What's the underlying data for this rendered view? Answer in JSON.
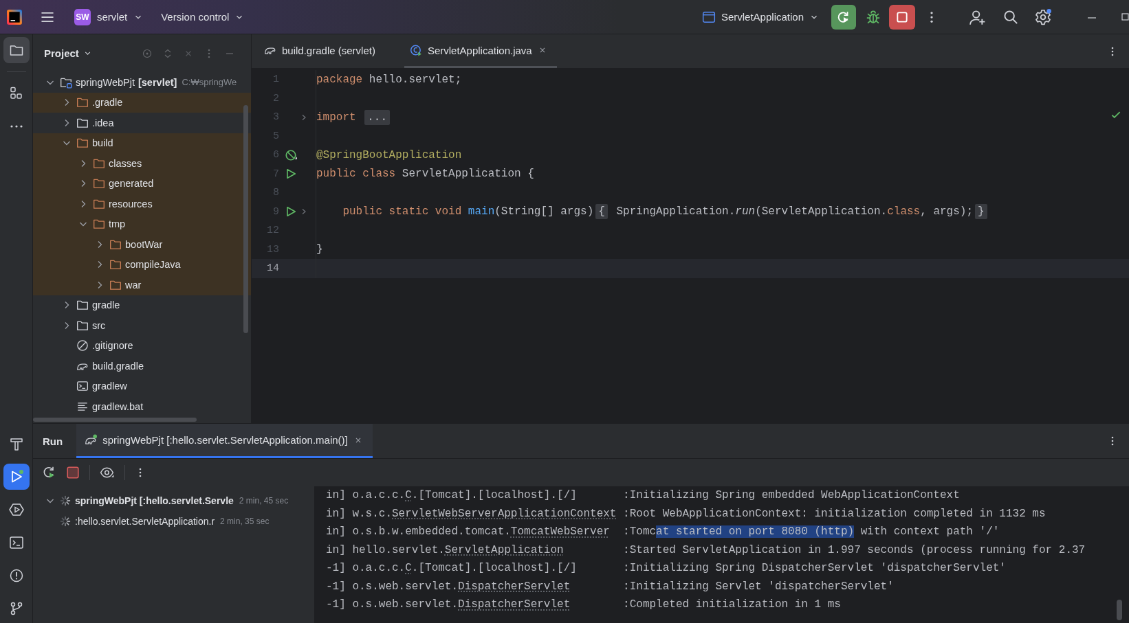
{
  "title_bar": {
    "project_badge": "SW",
    "project_name": "servlet",
    "vcs": "Version control",
    "run_config": "ServletApplication"
  },
  "tool_strip": {
    "top": [
      {
        "kind": "project",
        "selected": true
      },
      {
        "kind": "structure",
        "selected": false
      },
      {
        "kind": "more",
        "selected": false
      }
    ],
    "bottom": [
      {
        "kind": "build",
        "selected": false
      },
      {
        "kind": "run",
        "selected": true
      },
      {
        "kind": "services",
        "selected": false
      },
      {
        "kind": "terminal",
        "selected": false
      },
      {
        "kind": "problems",
        "selected": false
      },
      {
        "kind": "vcs",
        "selected": false
      }
    ]
  },
  "project_panel": {
    "title": "Project",
    "tree": [
      {
        "name": "springWebPjt",
        "module": "[servlet]",
        "path": "C:₩springWe",
        "kind": "module",
        "expanded": true,
        "children": [
          {
            "name": ".gradle",
            "kind": "folder",
            "excluded": true,
            "expanded": false
          },
          {
            "name": ".idea",
            "kind": "folder",
            "excluded": false,
            "expanded": false
          },
          {
            "name": "build",
            "kind": "folder",
            "excluded": true,
            "expanded": true,
            "children": [
              {
                "name": "classes",
                "kind": "folder",
                "excluded": true,
                "expanded": false
              },
              {
                "name": "generated",
                "kind": "folder",
                "excluded": true,
                "expanded": false
              },
              {
                "name": "resources",
                "kind": "folder",
                "excluded": true,
                "expanded": false
              },
              {
                "name": "tmp",
                "kind": "folder",
                "excluded": true,
                "expanded": true,
                "children": [
                  {
                    "name": "bootWar",
                    "kind": "folder",
                    "excluded": true,
                    "expanded": false
                  },
                  {
                    "name": "compileJava",
                    "kind": "folder",
                    "excluded": true,
                    "expanded": false
                  },
                  {
                    "name": "war",
                    "kind": "folder",
                    "excluded": true,
                    "expanded": false
                  }
                ]
              }
            ]
          },
          {
            "name": "gradle",
            "kind": "folder",
            "excluded": false,
            "expanded": false
          },
          {
            "name": "src",
            "kind": "folder",
            "excluded": false,
            "expanded": false
          },
          {
            "name": ".gitignore",
            "kind": "ignore"
          },
          {
            "name": "build.gradle",
            "kind": "gradle"
          },
          {
            "name": "gradlew",
            "kind": "script"
          },
          {
            "name": "gradlew.bat",
            "kind": "text"
          }
        ]
      }
    ]
  },
  "editor": {
    "tabs": [
      {
        "label": "build.gradle (servlet)",
        "kind": "gradle",
        "selected": false,
        "closable": false
      },
      {
        "label": "ServletApplication.java",
        "kind": "java",
        "selected": true,
        "closable": true
      }
    ],
    "lines": [
      {
        "number": "1",
        "kind": "plain",
        "current": false,
        "foldable": false,
        "tokens": [
          {
            "text": "package ",
            "kind": "keyword"
          },
          {
            "text": "hello.servlet;",
            "kind": "plain"
          }
        ]
      },
      {
        "number": "2",
        "kind": "plain",
        "current": false,
        "foldable": false
      },
      {
        "number": "3",
        "kind": "plain",
        "current": false,
        "foldable": true,
        "tokens": [
          {
            "text": "import ",
            "kind": "keyword"
          },
          {
            "text": "...",
            "kind": "fold"
          }
        ]
      },
      {
        "number": "5",
        "kind": "plain",
        "current": false,
        "foldable": false
      },
      {
        "number": "6",
        "kind": "bean",
        "current": false,
        "foldable": false,
        "tokens": [
          {
            "text": "@SpringBootApplication",
            "kind": "annotation"
          }
        ]
      },
      {
        "number": "7",
        "kind": "run",
        "current": false,
        "foldable": false,
        "tokens": [
          {
            "text": "public class ",
            "kind": "keyword"
          },
          {
            "text": "ServletApplication {",
            "kind": "plain"
          }
        ]
      },
      {
        "number": "8",
        "kind": "plain",
        "current": false,
        "foldable": false
      },
      {
        "number": "9",
        "kind": "run",
        "current": false,
        "foldable": true,
        "tokens": [
          {
            "text": "    public static void ",
            "kind": "keyword"
          },
          {
            "text": "main",
            "kind": "method"
          },
          {
            "text": "(String[] args)",
            "kind": "plain"
          },
          {
            "text": "{",
            "kind": "fold"
          },
          {
            "text": " SpringApplication.",
            "kind": "plain"
          },
          {
            "text": "run",
            "kind": "static"
          },
          {
            "text": "(ServletApplication.",
            "kind": "plain"
          },
          {
            "text": "class",
            "kind": "keyword"
          },
          {
            "text": ", args);",
            "kind": "plain"
          },
          {
            "text": "}",
            "kind": "fold"
          }
        ]
      },
      {
        "number": "12",
        "kind": "plain",
        "current": false,
        "foldable": false
      },
      {
        "number": "13",
        "kind": "plain",
        "current": false,
        "foldable": false,
        "tokens": [
          {
            "text": "}",
            "kind": "plain"
          }
        ]
      },
      {
        "number": "14",
        "kind": "plain",
        "current": true,
        "foldable": false
      }
    ]
  },
  "run_panel": {
    "title": "Run",
    "tabs": [
      {
        "label": "springWebPjt [:hello.servlet.ServletApplication.main()]",
        "selected": true,
        "closable": true
      }
    ],
    "tree": [
      {
        "label": "springWebPjt [:hello.servlet.Servle",
        "time": "2 min, 45 sec",
        "running": true,
        "expanded": true,
        "children": [
          {
            "label": ":hello.servlet.ServletApplication.r",
            "time": "2 min, 35 sec",
            "running": true
          }
        ]
      }
    ],
    "console": [
      {
        "thread": "in]",
        "logger": [
          {
            "text": "o.a.c.c.",
            "linked": false
          },
          {
            "text": "C",
            "linked": true
          },
          {
            "text": ".[Tomcat].[localhost].[/]",
            "linked": false
          }
        ],
        "separator": ":",
        "message": [
          {
            "text": "Initializing Spring embedded WebApplicationContext",
            "selected": false
          }
        ]
      },
      {
        "thread": "in]",
        "logger": [
          {
            "text": "w.s.c.",
            "linked": false
          },
          {
            "text": "ServletWebServerApplicationContext",
            "linked": true
          }
        ],
        "separator": ":",
        "message": [
          {
            "text": "Root WebApplicationContext: initialization completed in 1132 ms",
            "selected": false
          }
        ]
      },
      {
        "thread": "in]",
        "logger": [
          {
            "text": "o.s.b.w.embedded.tomcat.",
            "linked": false
          },
          {
            "text": "TomcatWebServer",
            "linked": true
          }
        ],
        "separator": ":",
        "message": [
          {
            "text": "Tomc",
            "selected": false
          },
          {
            "text": "at started on port 8080 (http)",
            "selected": true
          },
          {
            "text": " with context path '/'",
            "selected": false
          }
        ]
      },
      {
        "thread": "in]",
        "logger": [
          {
            "text": "hello.servlet.",
            "linked": false
          },
          {
            "text": "ServletApplication",
            "linked": true
          }
        ],
        "separator": ":",
        "message": [
          {
            "text": "Started ServletApplication in 1.997 seconds (process running for 2.37",
            "selected": false
          }
        ]
      },
      {
        "thread": "-1]",
        "logger": [
          {
            "text": "o.a.c.c.",
            "linked": false
          },
          {
            "text": "C",
            "linked": true
          },
          {
            "text": ".[Tomcat].[localhost].[/]",
            "linked": false
          }
        ],
        "separator": ":",
        "message": [
          {
            "text": "Initializing Spring DispatcherServlet 'dispatcherServlet'",
            "selected": false
          }
        ]
      },
      {
        "thread": "-1]",
        "logger": [
          {
            "text": "o.s.web.servlet.",
            "linked": false
          },
          {
            "text": "DispatcherServlet",
            "linked": true
          }
        ],
        "separator": ":",
        "message": [
          {
            "text": "Initializing Servlet 'dispatcherServlet'",
            "selected": false
          }
        ]
      },
      {
        "thread": "-1]",
        "logger": [
          {
            "text": "o.s.web.servlet.",
            "linked": false
          },
          {
            "text": "DispatcherServlet",
            "linked": true
          }
        ],
        "separator": ":",
        "message": [
          {
            "text": "Completed initialization in 1 ms",
            "selected": false
          }
        ]
      }
    ]
  }
}
